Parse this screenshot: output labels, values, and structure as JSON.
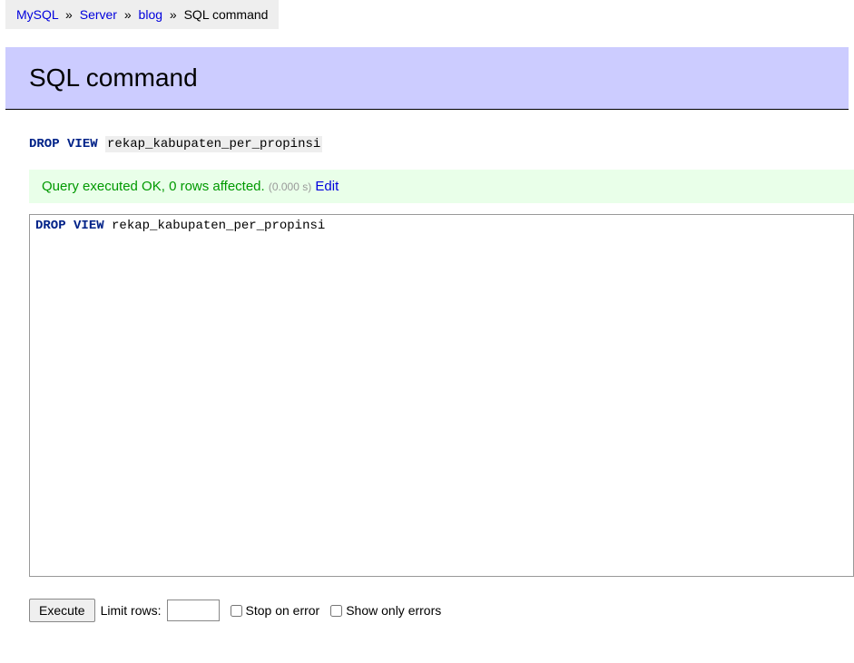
{
  "breadcrumb": {
    "items": [
      {
        "label": "MySQL"
      },
      {
        "label": "Server"
      },
      {
        "label": "blog"
      }
    ],
    "current": "SQL command",
    "separator": "»"
  },
  "header": {
    "title": "SQL command"
  },
  "sql": {
    "keyword1": "DROP",
    "keyword2": "VIEW",
    "object": "rekap_kabupaten_per_propinsi"
  },
  "message": {
    "ok_text": "Query executed OK, 0 rows affected.",
    "timing": "(0.000 s)",
    "edit_label": "Edit"
  },
  "editor": {
    "keyword1": "DROP",
    "keyword2": "VIEW",
    "object": "rekap_kabupaten_per_propinsi"
  },
  "controls": {
    "execute_label": "Execute",
    "limit_label": "Limit rows:",
    "limit_value": "",
    "stop_on_error_label": "Stop on error",
    "show_only_errors_label": "Show only errors"
  }
}
